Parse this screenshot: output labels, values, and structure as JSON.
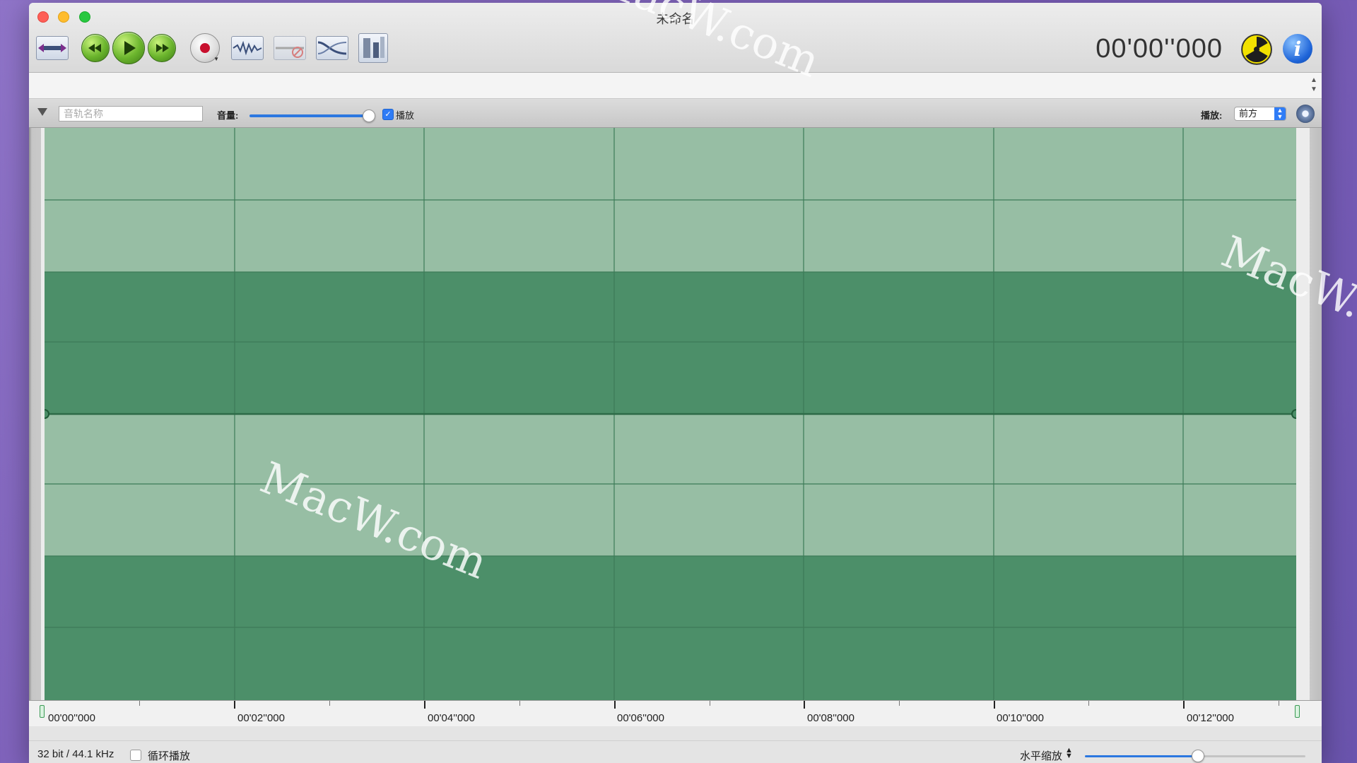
{
  "window": {
    "title": "未命名"
  },
  "toolbar": {
    "timecode": "00'00''000"
  },
  "track": {
    "name_placeholder": "音轨名称",
    "volume_label": "音量:",
    "volume_level": 0.92,
    "play_checkbox_label": "播放",
    "play_checked": true,
    "playback_label": "播放:",
    "playback_option": "前方"
  },
  "ruler": {
    "labels": [
      "00'00''000",
      "00'02''000",
      "00'04''000",
      "00'06''000",
      "00'08''000",
      "00'10''000",
      "00'12''000"
    ]
  },
  "status": {
    "format": "32 bit / 44.1 kHz",
    "loop_label": "循环播放",
    "loop_checked": false,
    "zoom_label": "水平缩放",
    "zoom_level": 0.54
  },
  "watermark": {
    "text": "MacW.com"
  },
  "colors": {
    "wave_light": "#97bea4",
    "wave_dark": "#4c8f69",
    "grid": "#3d7b57",
    "accent": "#2f7cf6"
  }
}
